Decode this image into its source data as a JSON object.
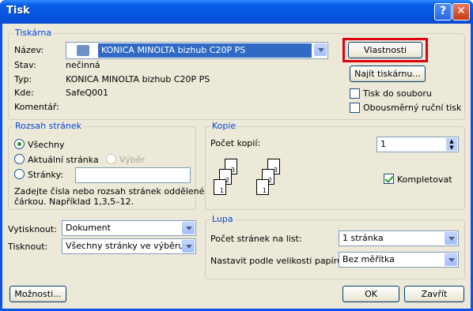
{
  "window": {
    "title": "Tisk",
    "help_label": "?",
    "close_label": "✕"
  },
  "printer": {
    "group_label": "Tiskárna",
    "name_label": "Název:",
    "name_value": "KONICA MINOLTA bizhub C20P PS",
    "status_label": "Stav:",
    "status_value": "nečinná",
    "type_label": "Typ:",
    "type_value": "KONICA MINOLTA bizhub C20P PS",
    "where_label": "Kde:",
    "where_value": "SafeQ001",
    "comment_label": "Komentář:",
    "properties_button": "Vlastnosti",
    "find_button": "Najít tiskárnu...",
    "print_to_file": "Tisk do souboru",
    "duplex_manual": "Obousměrný ruční tisk",
    "highlight_color": "#e0000f"
  },
  "range": {
    "group_label": "Rozsah stránek",
    "all": "Všechny",
    "current": "Aktuální stránka",
    "selection": "Výběr",
    "pages": "Stránky:",
    "pages_value": "",
    "hint_line1": "Zadejte čísla nebo rozsah stránek oddělené",
    "hint_line2": "čárkou. Například 1,3,5–12."
  },
  "copies": {
    "group_label": "Kopie",
    "count_label": "Počet kopií:",
    "count_value": "1",
    "collate": "Kompletovat",
    "page_numbers": [
      "3",
      "2",
      "1"
    ]
  },
  "print_what": {
    "print_what_label": "Vytisknout:",
    "print_what_value": "Dokument",
    "print_label": "Tisknout:",
    "print_value": "Všechny stránky ve výběru"
  },
  "zoom": {
    "group_label": "Lupa",
    "pages_per_sheet_label": "Počet stránek na list:",
    "pages_per_sheet_value": "1 stránka",
    "scale_label": "Nastavit podle velikosti papíru:",
    "scale_value": "Bez měřítka"
  },
  "footer": {
    "options_button": "Možnosti...",
    "ok_button": "OK",
    "close_button": "Zavřít"
  }
}
